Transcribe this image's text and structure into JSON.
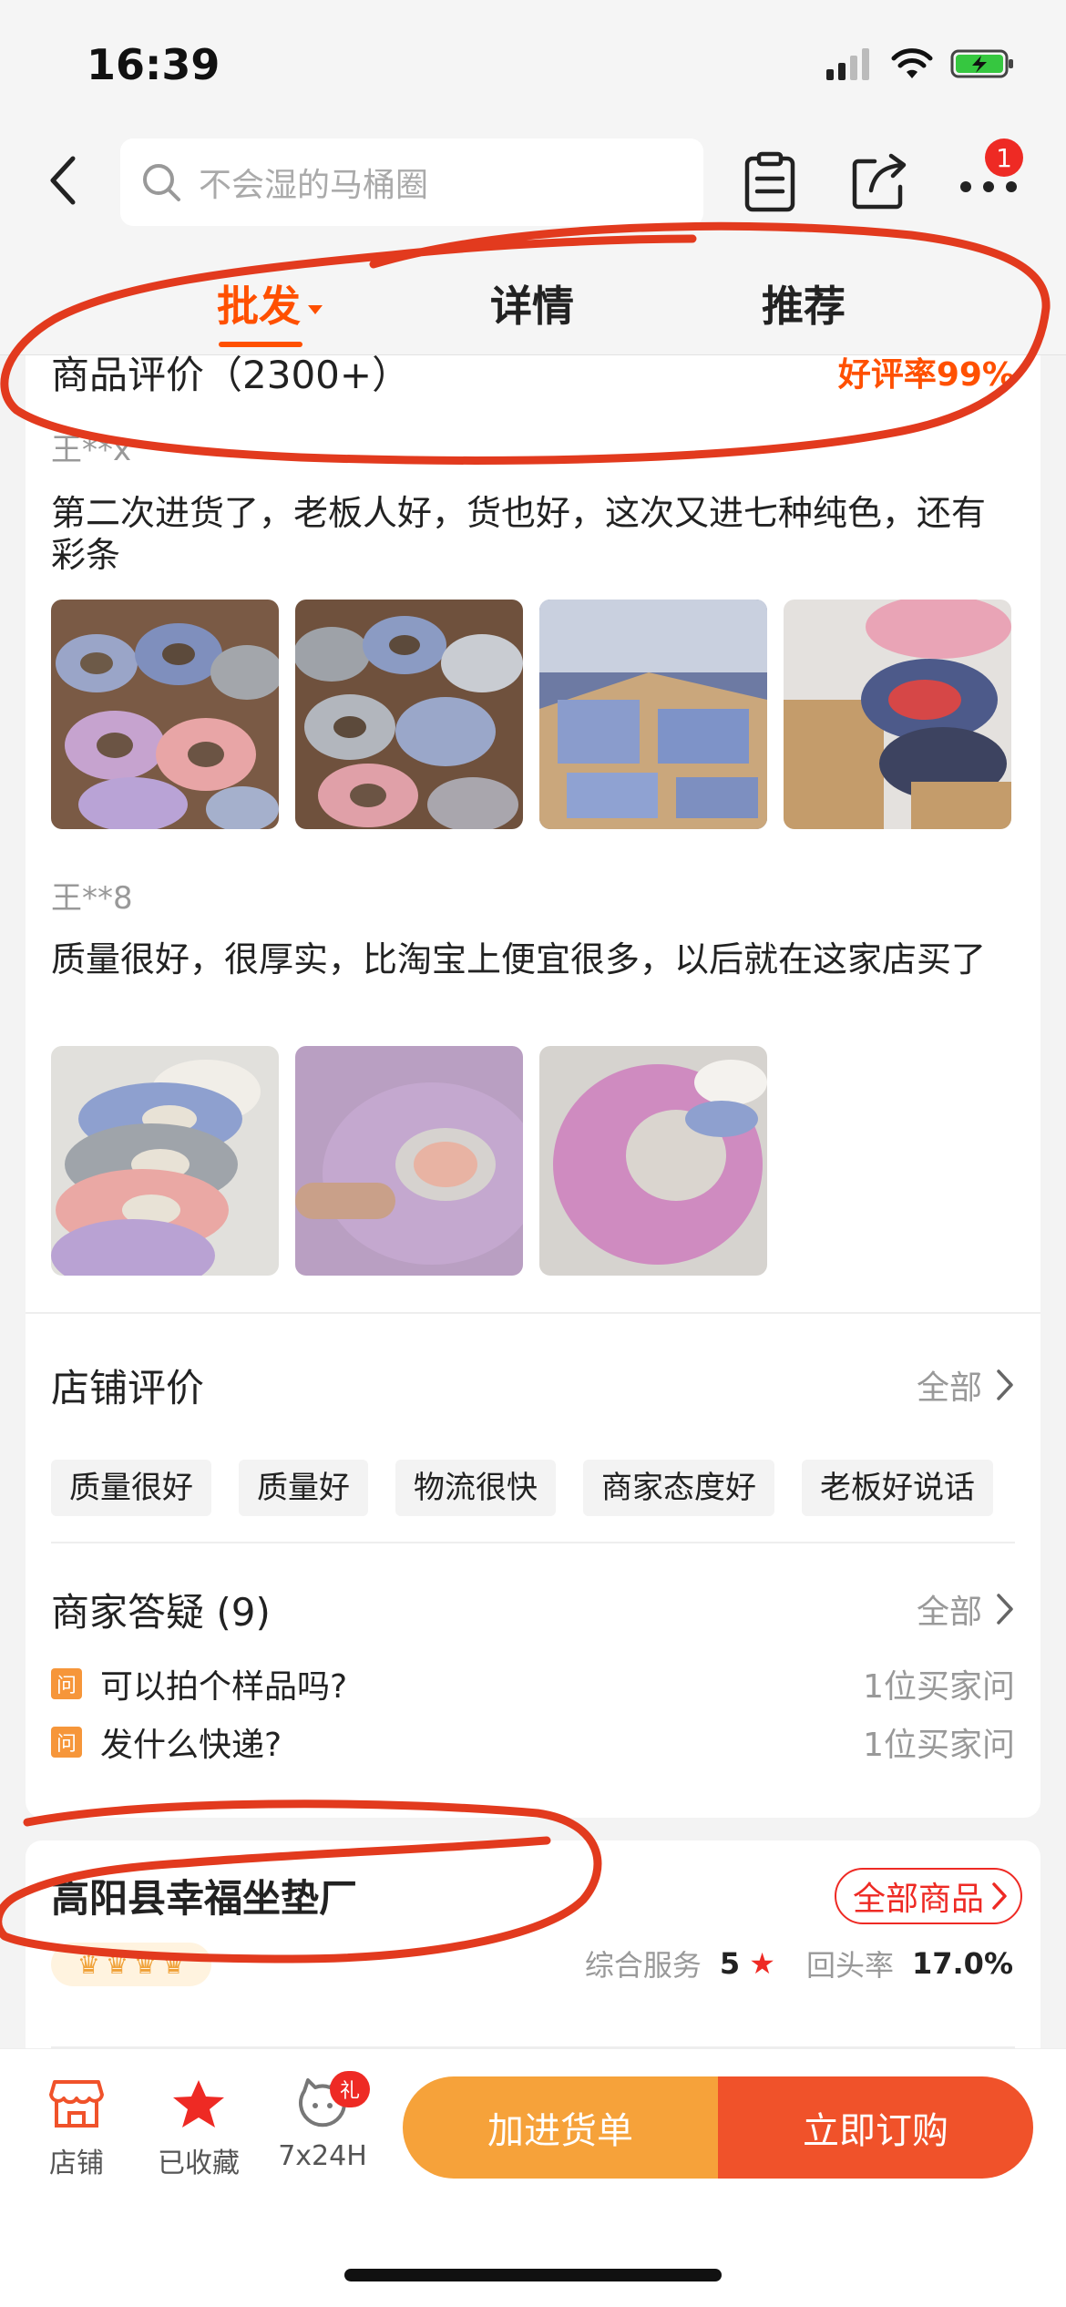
{
  "status_bar": {
    "time": "16:39"
  },
  "nav": {
    "search_placeholder": "不会湿的马桶圈",
    "cart_badge": "1"
  },
  "tabs": [
    {
      "label": "批发",
      "active": true
    },
    {
      "label": "详情",
      "active": false
    },
    {
      "label": "推荐",
      "active": false
    }
  ],
  "reviews": {
    "title": "商品评价（2300+）",
    "rate": "好评率99%",
    "items": [
      {
        "user": "王**x",
        "text": "第二次进货了，老板人好，货也好，这次又进七种纯色，还有彩条",
        "photo_count": 4
      },
      {
        "user": "王**8",
        "text": "质量很好，很厚实，比淘宝上便宜很多，以后就在这家店买了",
        "photo_count": 3
      }
    ]
  },
  "shop_reviews": {
    "title": "店铺评价",
    "all_label": "全部",
    "tags": [
      "质量很好",
      "质量好",
      "物流很快",
      "商家态度好",
      "老板好说话"
    ]
  },
  "qa": {
    "title": "商家答疑 (9)",
    "all_label": "全部",
    "q_icon": "问",
    "items": [
      {
        "question": "可以拍个样品吗?",
        "count": "1位买家问"
      },
      {
        "question": "发什么快递?",
        "count": "1位买家问"
      }
    ]
  },
  "shop": {
    "name": "高阳县幸福坐垫厂",
    "all_products": "全部商品",
    "service_label": "综合服务",
    "service_score": "5",
    "repeat_label": "回头率",
    "repeat_value": "17.0%",
    "crown_count": 4
  },
  "bottom": {
    "store": "店铺",
    "favorited": "已收藏",
    "service": "7x24H",
    "gift_badge": "礼",
    "add_cart": "加进货单",
    "buy_now": "立即订购"
  },
  "colors": {
    "accent": "#ff5000",
    "red": "#ee2a24",
    "orange_btn": "#f6a23a",
    "red_btn": "#f0522a",
    "marker": "#e23a1e"
  }
}
